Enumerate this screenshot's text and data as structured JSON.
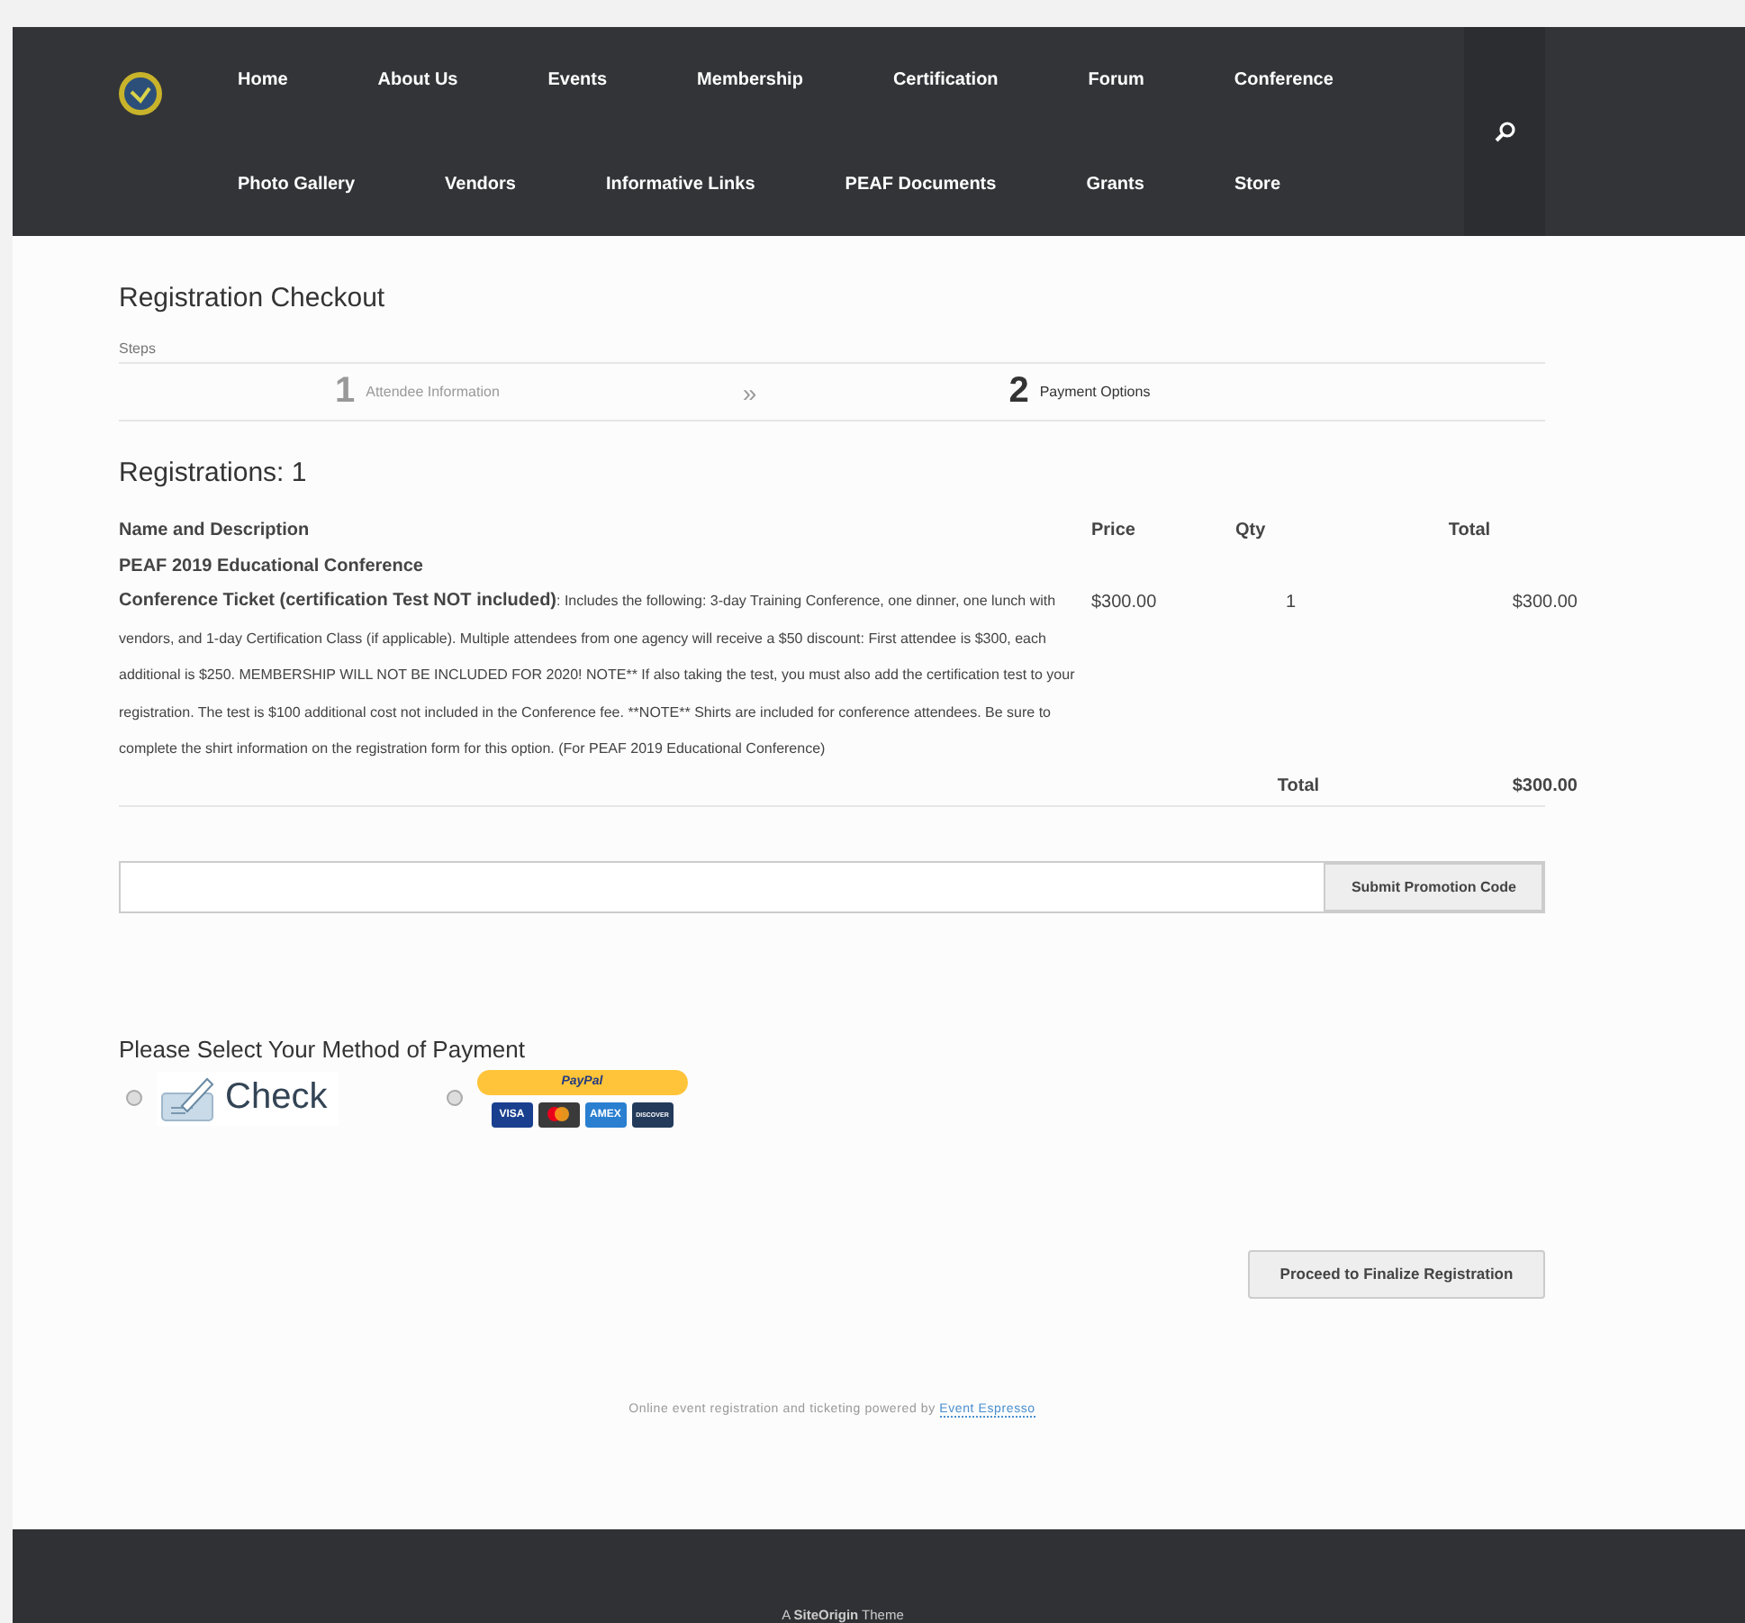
{
  "nav": {
    "items": [
      "Home",
      "About Us",
      "Events",
      "Membership",
      "Certification",
      "Forum",
      "Conference",
      "Photo Gallery",
      "Vendors",
      "Informative Links",
      "PEAF Documents",
      "Grants",
      "Store"
    ]
  },
  "page_title": "Registration Checkout",
  "steps": {
    "label": "Steps",
    "separator": "»",
    "items": [
      {
        "number": "1",
        "label": "Attendee Information",
        "selected": false
      },
      {
        "number": "2",
        "label": "Payment Options",
        "selected": true
      }
    ]
  },
  "registrations_heading": "Registrations: 1",
  "table": {
    "columns": [
      "Name and Description",
      "Price",
      "Qty",
      "Total"
    ],
    "event": "PEAF 2019 Educational Conference",
    "rows": [
      {
        "name": "Conference Ticket (certification Test NOT included)",
        "description": ": Includes the following: 3-day Training Conference, one dinner, one lunch with vendors, and 1-day Certification Class (if applicable). Multiple attendees from one agency will receive a $50 discount: First attendee is $300, each additional is $250. MEMBERSHIP WILL NOT BE INCLUDED FOR 2020! NOTE** If also taking the test, you must also add the certification test to your registration. The test is $100 additional cost not included in the Conference fee. **NOTE** Shirts are included for conference attendees. Be sure to complete the shirt information on the registration form for this option. (For PEAF 2019 Educational Conference)",
        "price": "$300.00",
        "qty": "1",
        "total": "$300.00"
      }
    ],
    "total_label": "Total",
    "total": "$300.00"
  },
  "promo": {
    "button": "Submit Promotion Code"
  },
  "payment": {
    "heading": "Please Select Your Method of Payment",
    "methods": [
      {
        "kind": "check",
        "label": "Check",
        "selected": false
      },
      {
        "kind": "paypal",
        "label": "PayPal",
        "selected": false,
        "cards": [
          {
            "kind": "text",
            "label": "VISA",
            "color": "#1a3f8f"
          },
          {
            "kind": "circles",
            "color": "#3a3a3a"
          },
          {
            "kind": "text",
            "label": "AMEX",
            "color": "#2a7fd0"
          },
          {
            "kind": "text",
            "label": "DISCOVER",
            "color": "#233a5a"
          }
        ]
      }
    ]
  },
  "proceed_button": "Proceed to Finalize Registration",
  "powered": {
    "text": "Online event registration and ticketing powered by",
    "link": "Event Espresso"
  },
  "footer": "A **SiteOrigin** Theme"
}
